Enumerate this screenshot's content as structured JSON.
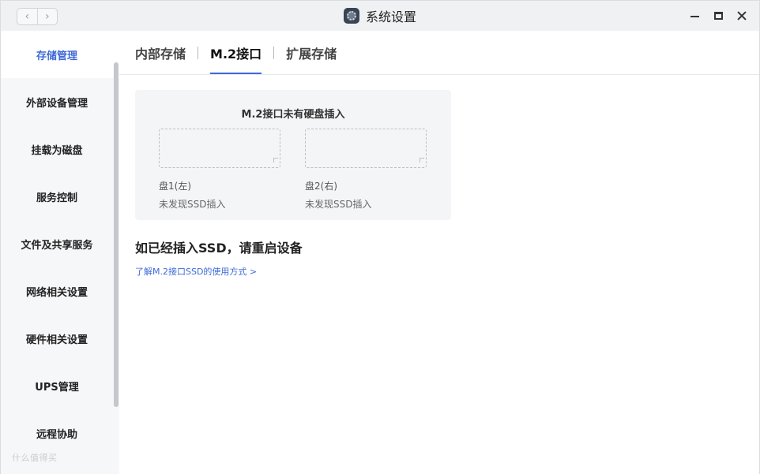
{
  "titlebar": {
    "title": "系统设置",
    "back_glyph": "‹",
    "forward_glyph": "›",
    "app_icon": "settings-app-icon"
  },
  "sidebar": {
    "items": [
      {
        "label": "存储管理",
        "active": true
      },
      {
        "label": "外部设备管理"
      },
      {
        "label": "挂载为磁盘"
      },
      {
        "label": "服务控制"
      },
      {
        "label": "文件及共享服务"
      },
      {
        "label": "网络相关设置"
      },
      {
        "label": "硬件相关设置"
      },
      {
        "label": "UPS管理"
      },
      {
        "label": "远程协助"
      }
    ],
    "watermark": "什么值得买"
  },
  "tabs": [
    {
      "label": "内部存储"
    },
    {
      "label": "M.2接口",
      "active": true
    },
    {
      "label": "扩展存储"
    }
  ],
  "m2_panel": {
    "title": "M.2接口未有硬盘插入",
    "slots": [
      {
        "label": "盘1(左)",
        "status": "未发现SSD插入"
      },
      {
        "label": "盘2(右)",
        "status": "未发现SSD插入"
      }
    ]
  },
  "hint": {
    "heading": "如已经插入SSD，请重启设备",
    "link": "了解M.2接口SSD的使用方式 >"
  },
  "colors": {
    "accent": "#3e6ad6",
    "sidebar_bg": "#f6f7f9",
    "panel_bg": "#f4f5f7"
  }
}
